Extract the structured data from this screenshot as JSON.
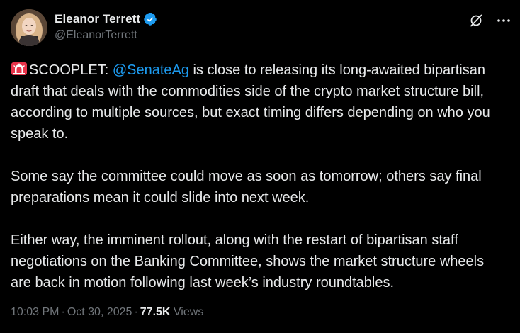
{
  "author": {
    "display_name": "Eleanor Terrett",
    "handle": "@EleanorTerrett",
    "verified": true,
    "verified_color": "#1d9bf0"
  },
  "header_icons": {
    "grok": "grok-icon",
    "more": "more-icon"
  },
  "tweet": {
    "emoji": "police-car-light",
    "p1_prefix": "SCOOPLET: ",
    "p1_mention": "@SenateAg",
    "p1_rest": " is close to releasing its long-awaited bipartisan draft that deals with the commodities side of the crypto market structure bill, according to multiple sources, but exact timing differs depending on who you speak to.",
    "p2": "Some say the committee could move as soon as tomorrow; others say final preparations mean it could slide into next week.",
    "p3": "Either way, the imminent rollout, along with the restart of bipartisan staff negotiations on the Banking Committee, shows the market structure wheels are back in motion following last week’s industry roundtables."
  },
  "meta": {
    "time": "10:03 PM",
    "dot1": "·",
    "date": "Oct 30, 2025",
    "dot2": "·",
    "views_count": "77.5K",
    "views_label": "Views"
  },
  "colors": {
    "background": "#000000",
    "text": "#e7e9ea",
    "secondary": "#71767b",
    "link": "#1d9bf0"
  }
}
